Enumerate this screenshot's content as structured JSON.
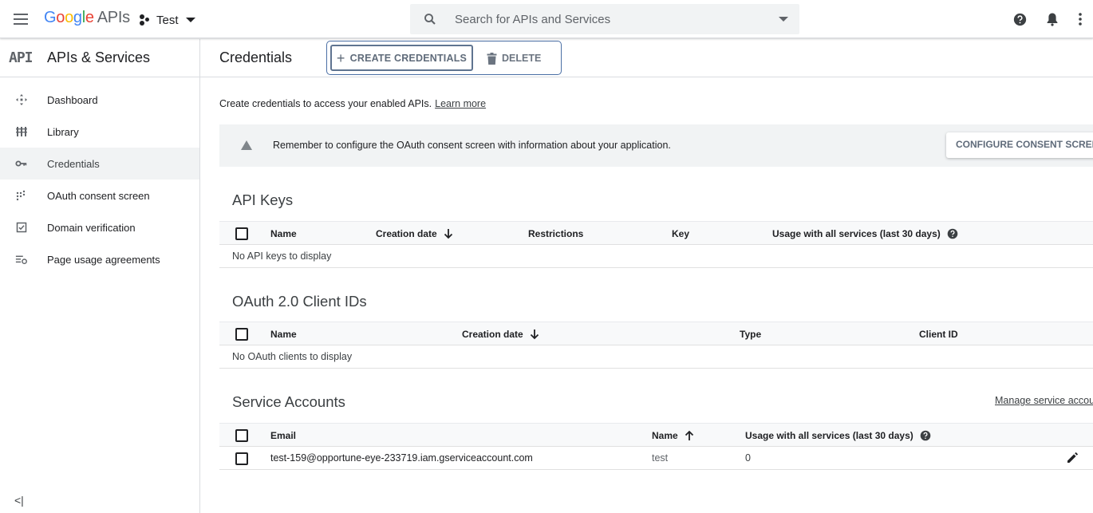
{
  "topbar": {
    "logo_google": [
      "G",
      "o",
      "o",
      "g",
      "l",
      "e"
    ],
    "logo_apis": "APIs",
    "project_name": "Test",
    "search_placeholder": "Search for APIs and Services"
  },
  "sidebar": {
    "header_mark": "API",
    "header_title": "APIs & Services",
    "items": [
      {
        "label": "Dashboard",
        "icon": "dashboard-icon",
        "active": false
      },
      {
        "label": "Library",
        "icon": "library-icon",
        "active": false
      },
      {
        "label": "Credentials",
        "icon": "key-icon",
        "active": true
      },
      {
        "label": "OAuth consent screen",
        "icon": "consent-icon",
        "active": false
      },
      {
        "label": "Domain verification",
        "icon": "checkbox-icon",
        "active": false
      },
      {
        "label": "Page usage agreements",
        "icon": "settings-list-icon",
        "active": false
      }
    ],
    "collapse_label": "<|"
  },
  "main": {
    "title": "Credentials",
    "create_label": "CREATE CREDENTIALS",
    "delete_label": "DELETE",
    "intro_text": "Create credentials to access your enabled APIs.",
    "learn_more": "Learn more",
    "banner_text": "Remember to configure the OAuth consent screen with information about your application.",
    "consent_button": "CONFIGURE CONSENT SCREEN"
  },
  "api_keys": {
    "title": "API Keys",
    "columns": [
      "Name",
      "Creation date",
      "Restrictions",
      "Key",
      "Usage with all services (last 30 days)"
    ],
    "empty_text": "No API keys to display"
  },
  "oauth": {
    "title": "OAuth 2.0 Client IDs",
    "columns": [
      "Name",
      "Creation date",
      "Type",
      "Client ID"
    ],
    "empty_text": "No OAuth clients to display"
  },
  "service_accounts": {
    "title": "Service Accounts",
    "manage_link": "Manage service accounts",
    "columns": [
      "Email",
      "Name",
      "Usage with all services (last 30 days)"
    ],
    "rows": [
      {
        "email": "test-159@opportune-eye-233719.iam.gserviceaccount.com",
        "name": "test",
        "usage": "0"
      }
    ]
  },
  "colors": {
    "accent_outline": "#4a6fa5",
    "text_primary": "#202124",
    "text_secondary": "#5f6368",
    "banner_bg": "#f1f3f4"
  }
}
